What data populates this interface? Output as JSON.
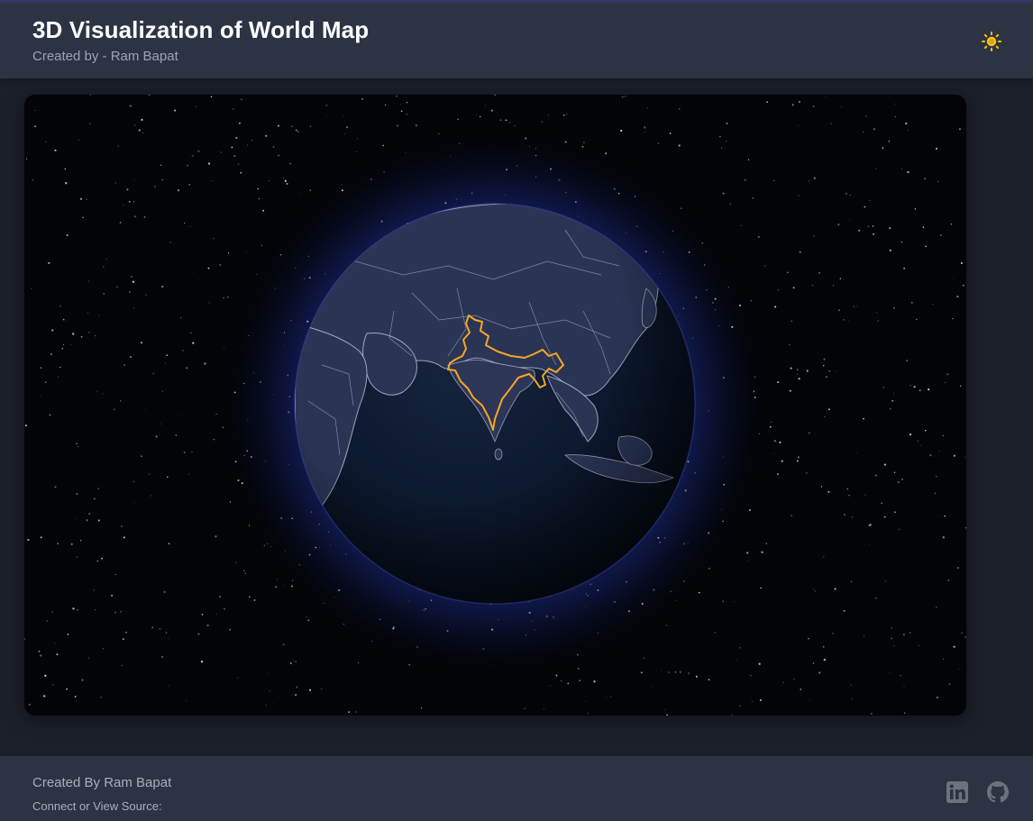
{
  "header": {
    "title": "3D Visualization of World Map",
    "subtitle": "Created by - Ram Bapat",
    "theme_toggle_icon": "sun-icon"
  },
  "globe": {
    "highlighted_country": "India",
    "highlight_color": "#f5a623",
    "border_color": "#c9cbe6",
    "atmosphere_color": "#2f49d6"
  },
  "footer": {
    "credit": "Created By Ram Bapat",
    "connect_label": "Connect or View Source:",
    "links": [
      {
        "icon": "linkedin-icon"
      },
      {
        "icon": "github-icon"
      }
    ]
  },
  "colors": {
    "accent": "#f5c518",
    "header_bg": "#2c3444",
    "page_bg": "#1b1f2a"
  }
}
